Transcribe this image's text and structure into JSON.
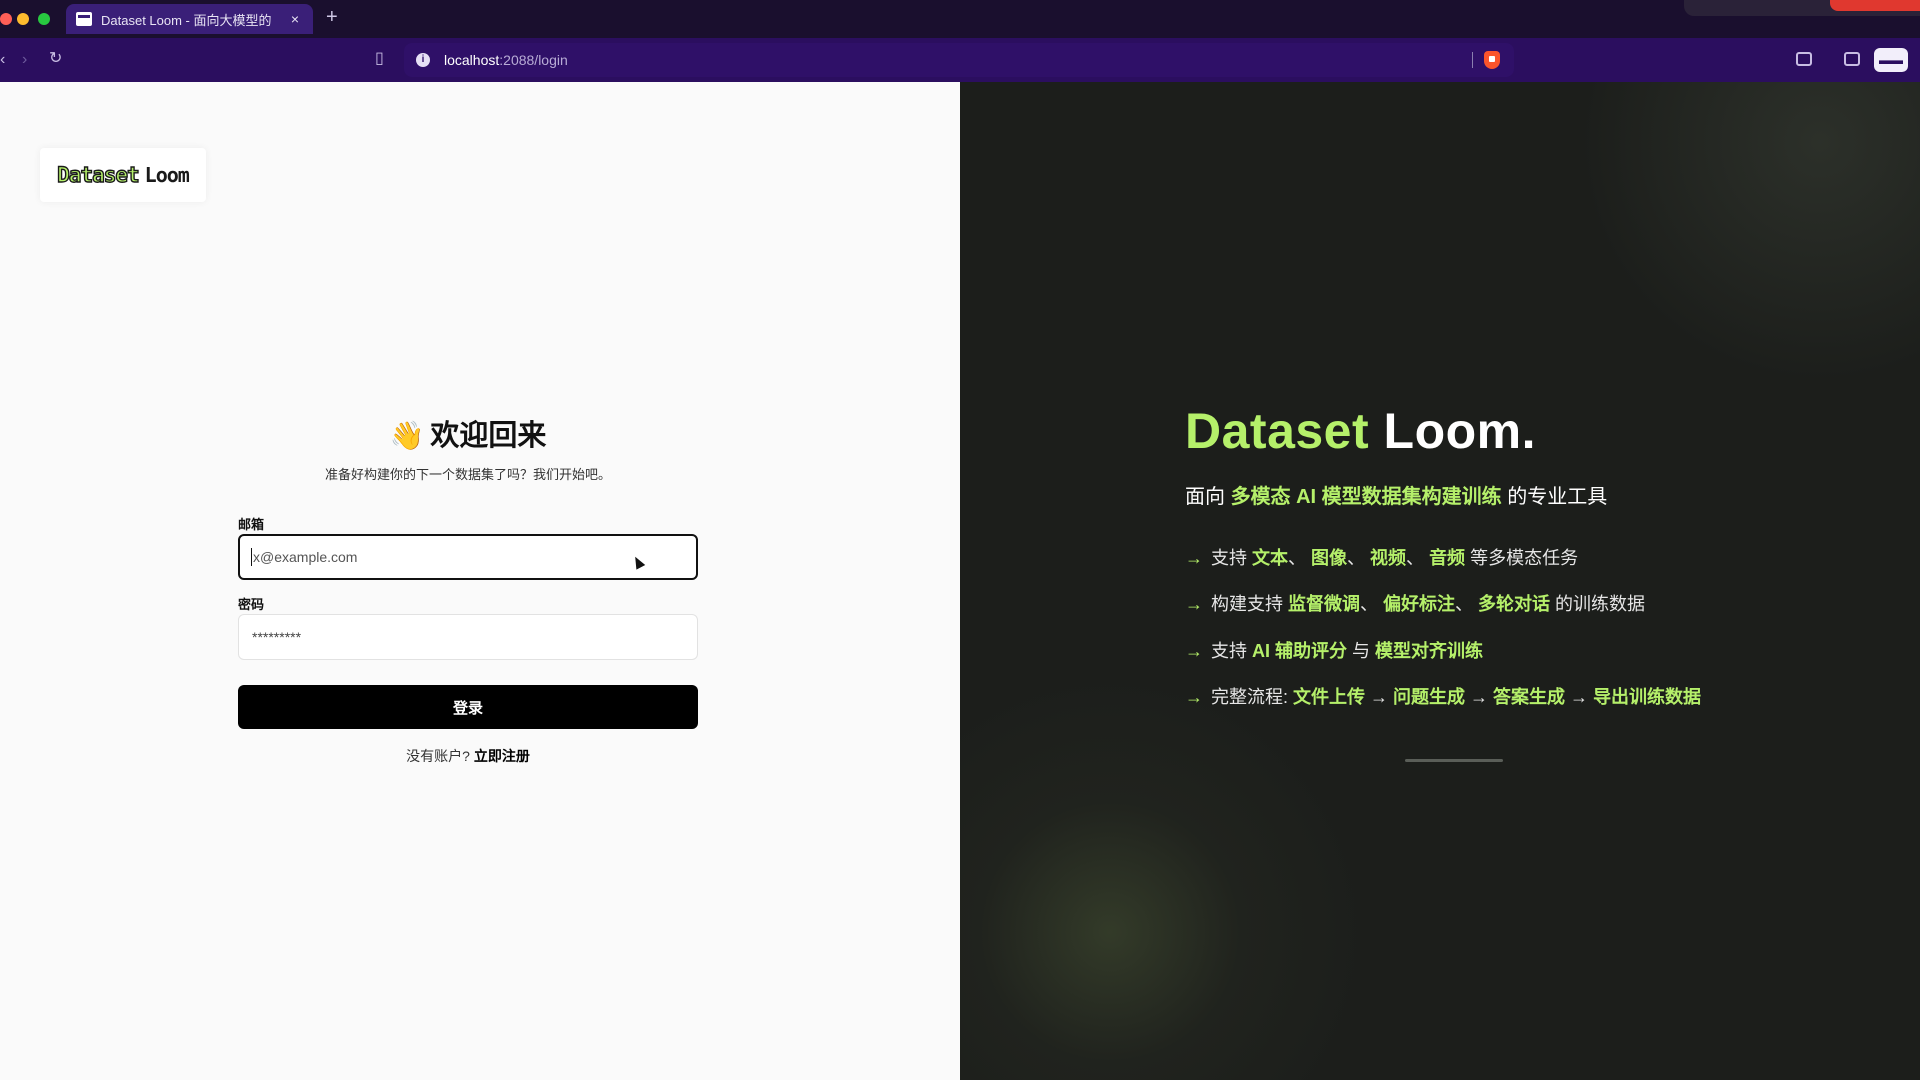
{
  "browser": {
    "tab_title": "Dataset Loom - 面向大模型的",
    "tab_close": "×",
    "new_tab": "+",
    "url_host": "localhost",
    "url_rest": ":2088/login"
  },
  "logo": {
    "part1": "Dataset",
    "part2": "Loom"
  },
  "login": {
    "wave": "👋",
    "title": "欢迎回来",
    "subtitle": "准备好构建你的下一个数据集了吗？我们开始吧。",
    "email_label": "邮箱",
    "email_placeholder": "x@example.com",
    "password_label": "密码",
    "password_placeholder": "*********",
    "submit_label": "登录",
    "no_account": "没有账户? ",
    "signup_link": "立即注册"
  },
  "hero": {
    "title_accent": "Dataset",
    "title_rest": " Loom.",
    "subtitle_pre": "面向 ",
    "subtitle_hl": "多模态 AI 模型数据集构建训练",
    "subtitle_post": " 的专业工具",
    "arrow": "→",
    "f1_pre": "支持 ",
    "f1_a": "文本",
    "f1_b": "图像",
    "f1_c": "视频",
    "f1_d": "音频",
    "sep": "、 ",
    "f1_post": " 等多模态任务",
    "f2_pre": "构建支持 ",
    "f2_a": "监督微调",
    "f2_b": "偏好标注",
    "f2_c": "多轮对话",
    "f2_post": " 的训练数据",
    "f3_pre": "支持 ",
    "f3_a": "AI 辅助评分",
    "f3_mid": " 与 ",
    "f3_b": "模型对齐训练",
    "f4_pre": "完整流程: ",
    "f4_a": "文件上传",
    "f4_b": "问题生成",
    "f4_c": "答案生成",
    "f4_d": "导出训练数据",
    "f4_arrow": " → "
  },
  "colors": {
    "accent": "#b5f06a",
    "dark_bg": "#1c1e1b",
    "light_bg": "#fafafa",
    "button": "#000000",
    "chrome": "#2b0e5f"
  }
}
